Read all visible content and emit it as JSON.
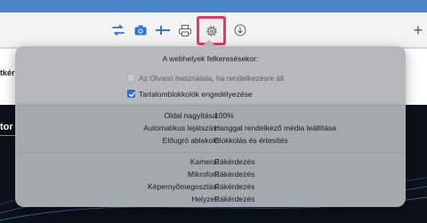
{
  "toolbar": {
    "icons": [
      "sync-icon",
      "camera-icon",
      "flag-icon",
      "print-icon",
      "gear-icon",
      "download-icon",
      "plus-icon"
    ],
    "new_tab_label": "+",
    "accent_color": "#2f72dc",
    "highlight_color": "#e8356a"
  },
  "page": {
    "left_snippet": "tkér",
    "left_dark_snippet": "tor"
  },
  "popover": {
    "title": "A webhelyek felkeresésekor:",
    "reader_label": "Az Olvasó használata, ha rendelkezésre áll",
    "reader_checked": false,
    "content_blockers_label": "Tartalomblokkolók engedélyezése",
    "content_blockers_checked": true,
    "settings1": [
      {
        "label": "Oldal nagyítása:",
        "value": "100%"
      },
      {
        "label": "Automatikus lejátszás:",
        "value": "Hanggal rendelkező média leállítása"
      },
      {
        "label": "Előugró ablakok:",
        "value": "Blokkolás és értesítés"
      }
    ],
    "settings2": [
      {
        "label": "Kamera:",
        "value": "Rákérdezés"
      },
      {
        "label": "Mikrofon:",
        "value": "Rákérdezés"
      },
      {
        "label": "Képernyőmegosztás:",
        "value": "Rákérdezés"
      },
      {
        "label": "Helyzet:",
        "value": "Rákérdezés"
      }
    ]
  }
}
